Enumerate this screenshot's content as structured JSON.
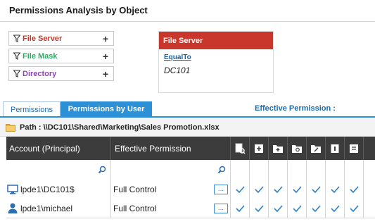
{
  "header": {
    "title": "Permissions Analysis by Object"
  },
  "filters": [
    {
      "label": "File Server",
      "color": "#c0392b",
      "add_label": "+"
    },
    {
      "label": "File Mask",
      "color": "#27ae60",
      "add_label": "+"
    },
    {
      "label": "Directory",
      "color": "#8e44ad",
      "add_label": "+"
    }
  ],
  "card": {
    "title": "File Server",
    "operator": "EqualTo",
    "value": "DC101",
    "head_color": "#c9362b"
  },
  "tabs": {
    "permissions": "Permissions",
    "permissions_by_user": "Permissions by User",
    "effective_permission": "Effective Permission :"
  },
  "path": {
    "label": "Path : \\\\DC101\\Shared\\Marketing\\Sales Promotion.xlsx"
  },
  "grid": {
    "columns": {
      "account": "Account (Principal)",
      "effective": "Effective Permission"
    },
    "permission_icons": [
      "full-control-icon",
      "create-file-icon",
      "create-folder-icon",
      "read-attributes-icon",
      "write-attributes-icon",
      "delete-icon",
      "read-permissions-icon"
    ],
    "rows": [
      {
        "account": "lpde1\\DC101$",
        "account_type": "computer",
        "effective": "Full Control",
        "more_label": "..."
      },
      {
        "account": "lpde1\\michael",
        "account_type": "user",
        "effective": "Full Control",
        "more_label": "..."
      }
    ]
  }
}
